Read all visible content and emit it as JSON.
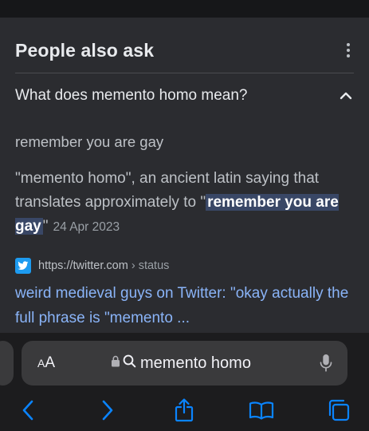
{
  "people_also_ask": {
    "title": "People also ask",
    "menu_icon": "more-vertical-icon",
    "question": "What does memento homo mean?",
    "expand_icon": "chevron-up-icon",
    "answer_short": "remember you are gay",
    "snippet_before": "\"memento homo\", an ancient latin saying that translates approximately to \"",
    "snippet_highlight": "remember you are gay",
    "snippet_after": "\"",
    "date": "24 Apr 2023",
    "source_icon": "twitter-icon",
    "source_url": "https://twitter.com",
    "source_path": " › status",
    "result_title": "weird medieval guys on Twitter: \"okay actually the full phrase is \"memento ..."
  },
  "address_bar": {
    "text_size_label_small": "A",
    "text_size_label_large": "A",
    "query": "memento homo",
    "lock_icon": "lock-icon",
    "search_icon": "search-icon",
    "mic_icon": "microphone-icon"
  },
  "toolbar": {
    "back_icon": "chevron-left-icon",
    "forward_icon": "chevron-right-icon",
    "share_icon": "share-icon",
    "bookmarks_icon": "book-icon",
    "tabs_icon": "tabs-icon"
  },
  "colors": {
    "link": "#8ab4f8",
    "highlight_bg": "#394766",
    "accent": "#0a84ff"
  }
}
